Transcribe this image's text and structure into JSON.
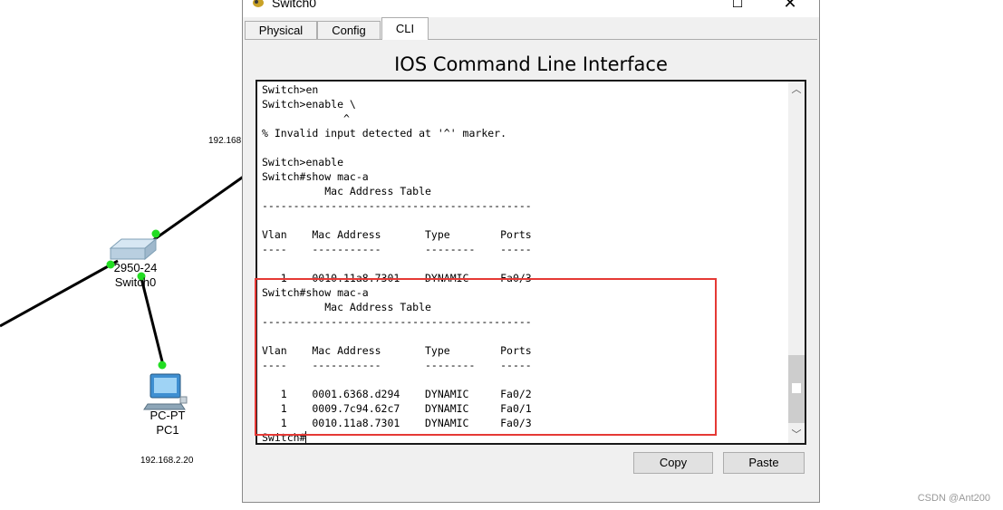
{
  "window": {
    "title": "Switch0",
    "close_glyph": "✕",
    "maximize_glyph": "☐",
    "tabs": [
      "Physical",
      "Config",
      "CLI"
    ],
    "active_tab": "CLI",
    "heading": "IOS Command Line Interface",
    "buttons": {
      "copy": "Copy",
      "paste": "Paste"
    }
  },
  "terminal": {
    "lines": [
      "Switch>en",
      "Switch>enable \\",
      "             ^",
      "% Invalid input detected at '^' marker.",
      "",
      "Switch>enable",
      "Switch#show mac-a",
      "          Mac Address Table",
      "-------------------------------------------",
      "",
      "Vlan    Mac Address       Type        Ports",
      "----    -----------       --------    -----",
      "",
      "   1    0010.11a8.7301    DYNAMIC     Fa0/3",
      "Switch#show mac-a",
      "          Mac Address Table",
      "-------------------------------------------",
      "",
      "Vlan    Mac Address       Type        Ports",
      "----    -----------       --------    -----",
      "",
      "   1    0001.6368.d294    DYNAMIC     Fa0/2",
      "   1    0009.7c94.62c7    DYNAMIC     Fa0/1",
      "   1    0010.11a8.7301    DYNAMIC     Fa0/3"
    ],
    "prompt": "Switch#",
    "highlight_color": "#e53935"
  },
  "topology": {
    "switch": {
      "model": "2950-24",
      "name": "Switch0",
      "icon": "switch-icon"
    },
    "pc": {
      "model": "PC-PT",
      "name": "PC1",
      "icon": "pc-icon",
      "ip": "192.168.2.20"
    },
    "partial_ip": "192.168",
    "link_color": "#000000",
    "port_up_color": "#22dd22"
  },
  "watermark": "CSDN @Ant200"
}
